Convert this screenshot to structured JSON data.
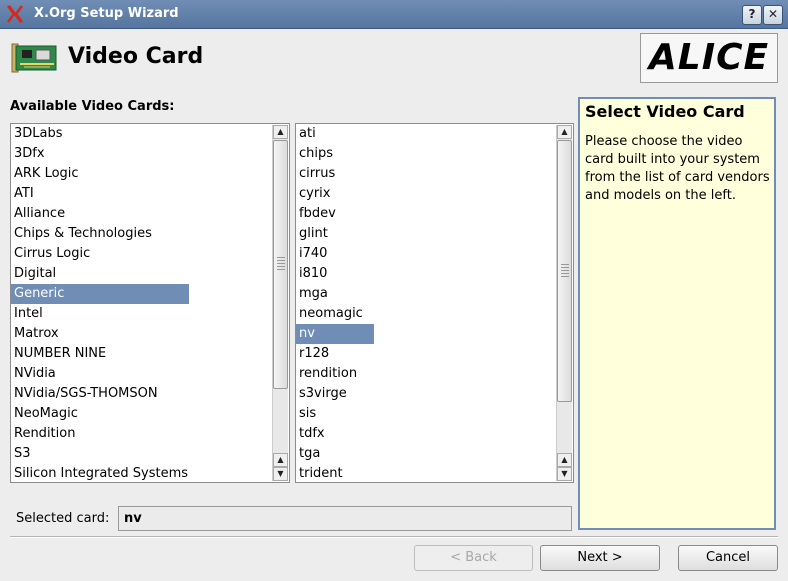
{
  "window": {
    "title": "X.Org Setup Wizard",
    "help_button": "?",
    "close_button": "✕"
  },
  "header": {
    "title": "Video Card",
    "brand": "ALICE"
  },
  "cards_label": "Available Video Cards:",
  "vendors": {
    "items": [
      "3DLabs",
      "3Dfx",
      "ARK Logic",
      "ATI",
      "Alliance",
      "Chips & Technologies",
      "Cirrus Logic",
      "Digital",
      "Generic",
      "Intel",
      "Matrox",
      "NUMBER NINE",
      "NVidia",
      "NVidia/SGS-THOMSON",
      "NeoMagic",
      "Rendition",
      "S3",
      "Silicon Integrated Systems"
    ],
    "selected": "Generic"
  },
  "drivers": {
    "items": [
      "ati",
      "chips",
      "cirrus",
      "cyrix",
      "fbdev",
      "glint",
      "i740",
      "i810",
      "mga",
      "neomagic",
      "nv",
      "r128",
      "rendition",
      "s3virge",
      "sis",
      "tdfx",
      "tga",
      "trident"
    ],
    "selected": "nv"
  },
  "help": {
    "title": "Select Video Card",
    "text": "Please choose the video card built into your system from the list of card vendors and models on the left."
  },
  "selected_card": {
    "label": "Selected card:",
    "value": "nv"
  },
  "buttons": {
    "back": "< Back",
    "next": "Next >",
    "cancel": "Cancel"
  },
  "colors": {
    "title_bar": "#6f8db5",
    "selection": "#6f8db5",
    "help_bg": "#ffffdc"
  }
}
